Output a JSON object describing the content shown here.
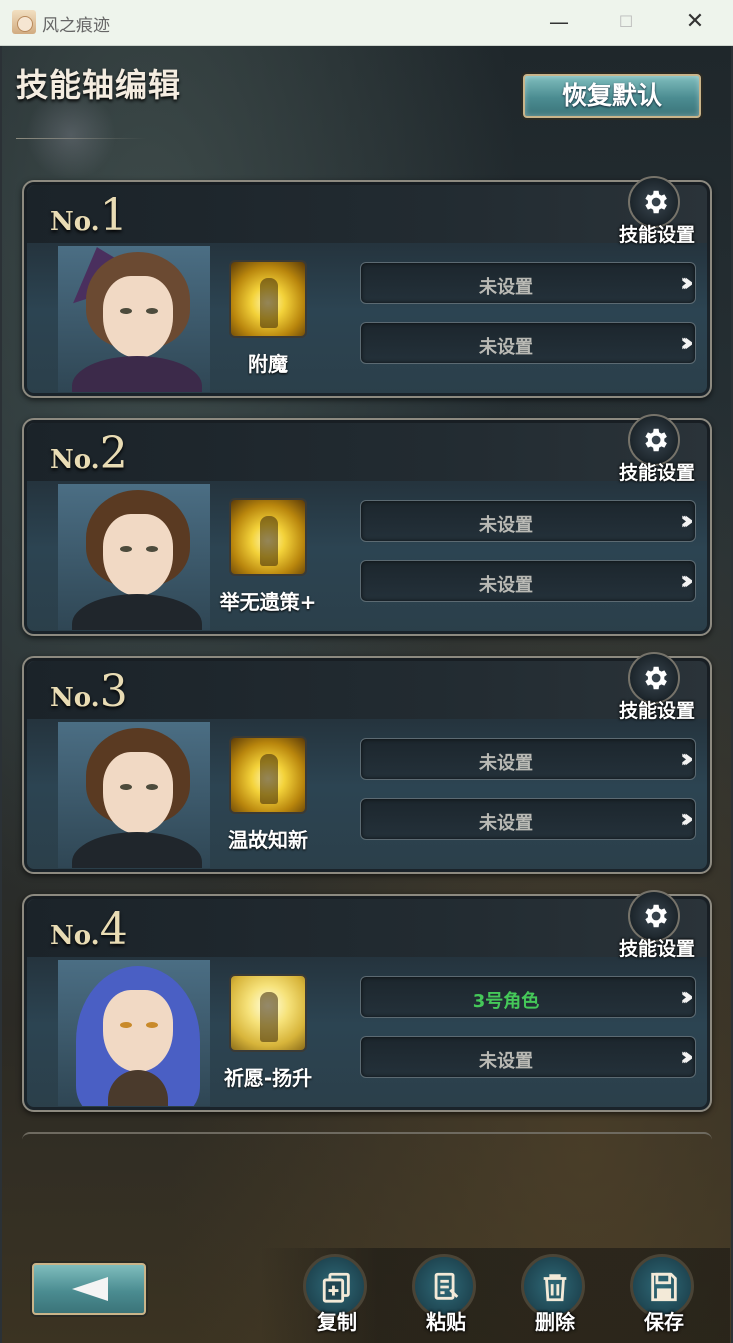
{
  "window": {
    "title": "风之痕迹",
    "minimize": "—",
    "maximize": "☐",
    "close": "✕"
  },
  "header": {
    "title": "技能轴编辑",
    "reset_button": "恢复默认"
  },
  "cards": [
    {
      "no": "No.",
      "num": "1",
      "settings_label": "技能设置",
      "skill_name": "附魔",
      "slot1": "未设置",
      "slot2": "未设置",
      "arrows": "›››"
    },
    {
      "no": "No.",
      "num": "2",
      "settings_label": "技能设置",
      "skill_name": "举无遗策+",
      "slot1": "未设置",
      "slot2": "未设置",
      "arrows": "›››"
    },
    {
      "no": "No.",
      "num": "3",
      "settings_label": "技能设置",
      "skill_name": "温故知新",
      "slot1": "未设置",
      "slot2": "未设置",
      "arrows": "›››"
    },
    {
      "no": "No.",
      "num": "4",
      "settings_label": "技能设置",
      "skill_name": "祈愿-扬升",
      "slot1": "3号角色",
      "slot2": "未设置",
      "arrows": "›››"
    }
  ],
  "bottom": {
    "copy": "复制",
    "paste": "粘贴",
    "delete": "删除",
    "save": "保存"
  },
  "colors": {
    "accent_teal": "#4b8c91",
    "gold_border": "#c9b48a",
    "slot_set_green": "#45c859"
  }
}
